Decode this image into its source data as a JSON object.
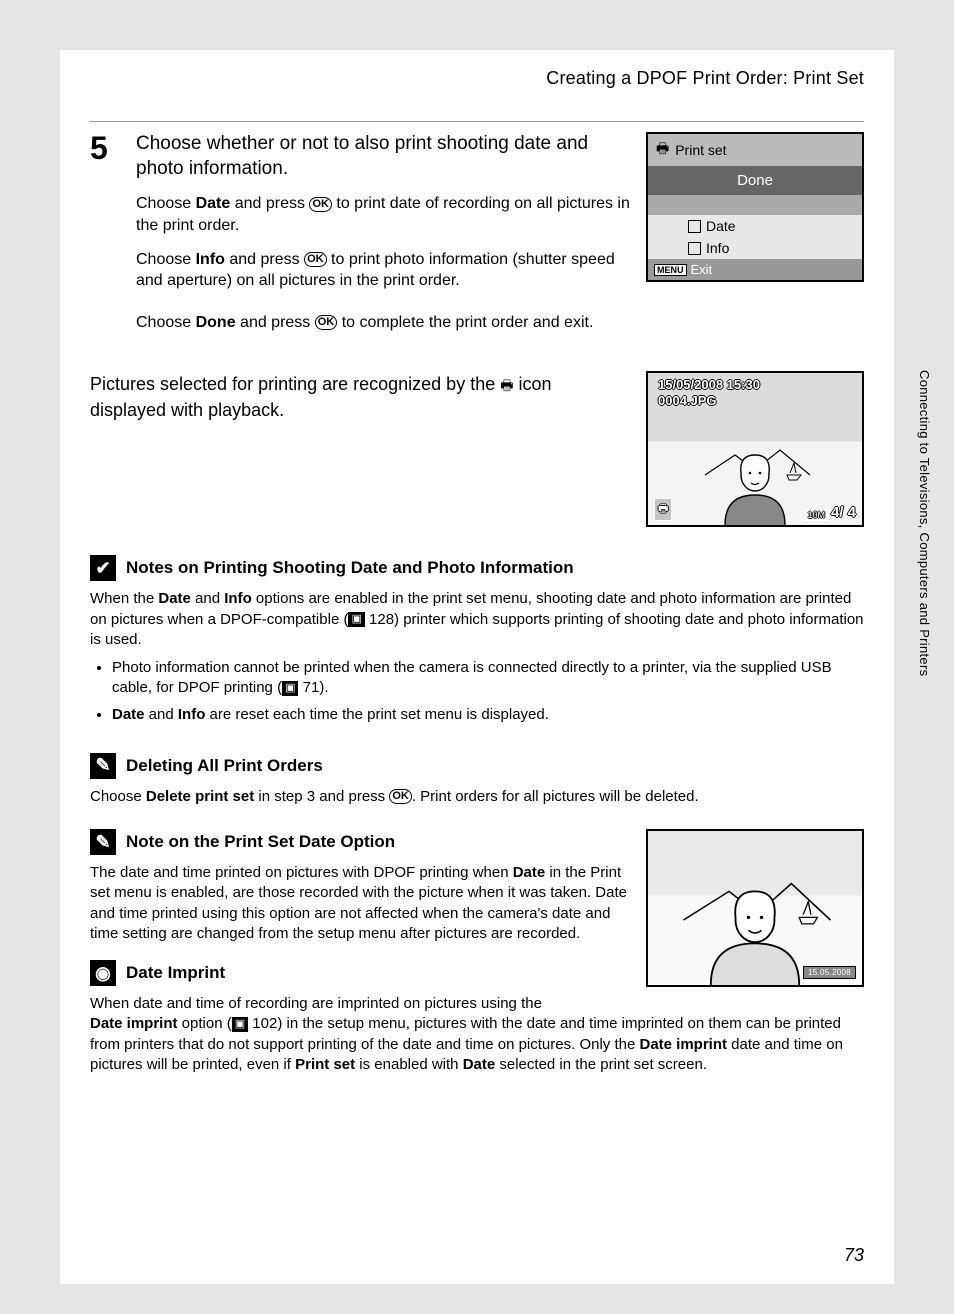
{
  "header": {
    "section_title": "Creating a DPOF Print Order: Print Set"
  },
  "step5": {
    "number": "5",
    "title": "Choose whether or not to also print shooting date and photo information.",
    "para1_pre": "Choose ",
    "para1_bold": "Date",
    "para1_mid": " and press ",
    "para1_post": " to print date of recording on all pictures in the print order.",
    "para2_pre": "Choose ",
    "para2_bold": "Info",
    "para2_mid": " and press ",
    "para2_post": " to print photo information (shutter speed and aperture) on all pictures in the print order.",
    "para3_pre": "Choose ",
    "para3_bold": "Done",
    "para3_mid": " and press ",
    "para3_post": " to complete the print order and exit."
  },
  "lcd1": {
    "title": "Print set",
    "done": "Done",
    "date": "Date",
    "info": "Info",
    "menu_label": "MENU",
    "exit": "Exit"
  },
  "playback": {
    "text_pre": "Pictures selected for printing are recognized by the ",
    "text_post": " icon displayed with playback."
  },
  "lcd2": {
    "timestamp": "15/05/2008 15:30",
    "filename": "0004.JPG",
    "counter": "4/    4",
    "size_badge": "10M"
  },
  "notes1": {
    "heading": "Notes on Printing Shooting Date and Photo Information",
    "body_a": "When the ",
    "body_b": "Date",
    "body_c": " and ",
    "body_d": "Info",
    "body_e": " options are enabled in the print set menu, shooting date and photo information are printed on pictures when a DPOF-compatible (",
    "body_f": " 128) printer which supports printing of shooting date and photo information is used.",
    "bullet1_a": "Photo information cannot be printed when the camera is connected directly to a printer, via the supplied USB cable, for DPOF printing (",
    "bullet1_b": " 71).",
    "bullet2_a": "Date",
    "bullet2_b": " and ",
    "bullet2_c": "Info",
    "bullet2_d": " are reset each time the print set menu is displayed."
  },
  "deleting": {
    "heading": "Deleting All Print Orders",
    "body_a": "Choose ",
    "body_b": "Delete print set",
    "body_c": " in step 3 and press ",
    "body_d": ". Print orders for all pictures will be deleted."
  },
  "dateopt": {
    "heading": "Note on the Print Set Date Option",
    "body_a": "The date and time printed on pictures with DPOF printing when ",
    "body_b": "Date",
    "body_c": " in the Print set menu is enabled, are those recorded with the picture when it was taken. Date and time printed using this option are not affected when the camera's date and time setting are changed from the setup menu after pictures are recorded."
  },
  "dateimprint": {
    "heading": "Date Imprint",
    "body_a": "When date and time of recording are imprinted on pictures using the ",
    "body_b": "Date imprint",
    "body_c": " option (",
    "body_d": " 102) in the setup menu, pictures with the date and time imprinted on them can be printed from printers that do not support printing of the date and time on pictures. Only the ",
    "body_e": "Date imprint",
    "body_f": " date and time on pictures will be printed, even if ",
    "body_g": "Print set",
    "body_h": " is enabled with ",
    "body_i": "Date",
    "body_j": " selected in the print set screen."
  },
  "lcd3": {
    "stamp": "15.05.2008"
  },
  "side": {
    "label": "Connecting to Televisions, Computers and Printers"
  },
  "page_number": "73",
  "ok_label": "OK"
}
